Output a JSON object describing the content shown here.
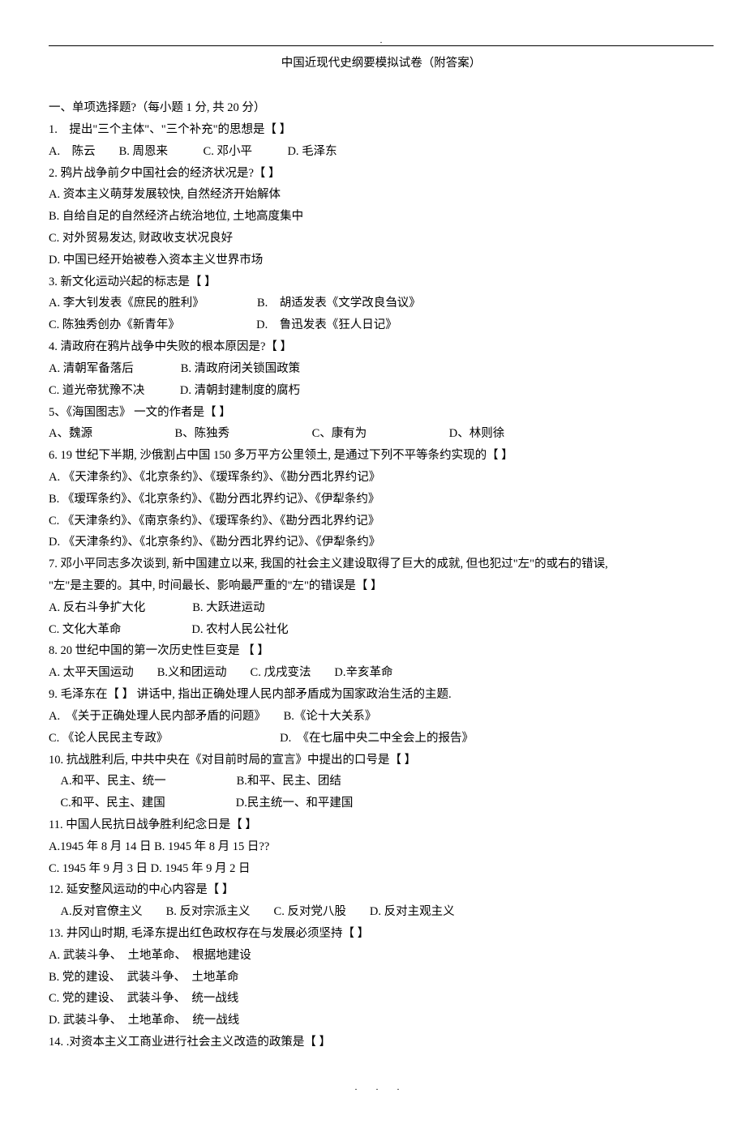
{
  "header_dot": ".",
  "title": "中国近现代史纲要模拟试卷（附答案）",
  "section1_header": "一、单项选择题?（每小题 1 分, 共 20 分）",
  "q1": {
    "stem": "1.　提出\"三个主体\"、\"三个补充\"的思想是【 】",
    "opts": "A.　陈云　　B. 周恩来　　　C. 邓小平　　　D. 毛泽东"
  },
  "q2": {
    "stem": "2. 鸦片战争前夕中国社会的经济状况是?【 】",
    "a": "A. 资本主义萌芽发展较快, 自然经济开始解体",
    "b": "B. 自给自足的自然经济占统治地位, 土地高度集中",
    "c": "C. 对外贸易发达, 财政收支状况良好",
    "d": "D. 中国已经开始被卷入资本主义世界市场"
  },
  "q3": {
    "stem": "3. 新文化运动兴起的标志是【 】",
    "row1": "A. 李大钊发表《庶民的胜利》　　　　　B.　胡适发表《文学改良刍议》",
    "row2": "C. 陈独秀创办《新青年》　　　　　　　D.　鲁迅发表《狂人日记》"
  },
  "q4": {
    "stem": "4. 清政府在鸦片战争中失败的根本原因是?【 】",
    "row1": "A. 清朝军备落后　　　　B. 清政府闭关锁国政策",
    "row2": "C. 道光帝犹豫不决　　　D. 清朝封建制度的腐朽"
  },
  "q5": {
    "stem": "5、《海国图志》 一文的作者是【 】",
    "opts": "A、魏源　　　　　　　B、陈独秀　　　　　　　C、康有为　　　　　　　D、林则徐"
  },
  "q6": {
    "stem": "6. 19 世纪下半期, 沙俄割占中国 150 多万平方公里领土, 是通过下列不平等条约实现的【 】",
    "a": "A. 《天津条约》、《北京条约》、《瑷珲条约》、《勘分西北界约记》",
    "b": "B. 《瑷珲条约》、《北京条约》、《勘分西北界约记》、《伊犁条约》",
    "c": "C. 《天津条约》、《南京条约》、《瑷珲条约》、《勘分西北界约记》",
    "d": "D. 《天津条约》、《北京条约》、《勘分西北界约记》、《伊犁条约》"
  },
  "q7": {
    "stem1": "7. 邓小平同志多次谈到, 新中国建立以来, 我国的社会主义建设取得了巨大的成就, 但也犯过\"左\"的或右的错误,",
    "stem2": "\"左\"是主要的。其中, 时间最长、影响最严重的\"左\"的错误是【 】",
    "row1": "A. 反右斗争扩大化　　　　B. 大跃进运动",
    "row2": "C. 文化大革命　　　　　　D. 农村人民公社化"
  },
  "q8": {
    "stem": "8. 20 世纪中国的第一次历史性巨变是 【 】",
    "opts": "A. 太平天国运动　　B.义和团运动　　C. 戊戌变法　　D.辛亥革命"
  },
  "q9": {
    "stem": "9. 毛泽东在【 】 讲话中, 指出正确处理人民内部矛盾成为国家政治生活的主题.",
    "row1": "A.　《关于正确处理人民内部矛盾的问题》　　B.《论十大关系》",
    "row2": "C. 《论人民民主专政》　　　　　　　　　　D.　《在七届中央二中全会上的报告》"
  },
  "q10": {
    "stem": "10. 抗战胜利后, 中共中央在《对目前时局的宣言》中提出的口号是【 】",
    "row1": "　A.和平、民主、统一　　　　　　B.和平、民主、团结",
    "row2": "　C.和平、民主、建国　　　　　　D.民主统一、和平建国"
  },
  "q11": {
    "stem": "11. 中国人民抗日战争胜利纪念日是【 】",
    "row1": "A.1945 年 8 月 14 日 B. 1945 年 8 月 15 日??",
    "row2": "C. 1945 年 9 月 3 日 D. 1945 年 9 月 2 日"
  },
  "q12": {
    "stem": "12. 延安整风运动的中心内容是【 】",
    "opts": "　A.反对官僚主义　　B. 反对宗派主义　　C. 反对党八股　　D. 反对主观主义"
  },
  "q13": {
    "stem": "13. 井冈山时期, 毛泽东提出红色政权存在与发展必须坚持【 】",
    "a": "A. 武装斗争、　土地革命、　根据地建设",
    "b": "B. 党的建设、　武装斗争、　土地革命",
    "c": "C. 党的建设、　武装斗争、　统一战线",
    "d": "D. 武装斗争、　土地革命、　统一战线"
  },
  "q14": {
    "stem": "14. .对资本主义工商业进行社会主义改造的政策是【 】"
  },
  "footer": ". . ."
}
